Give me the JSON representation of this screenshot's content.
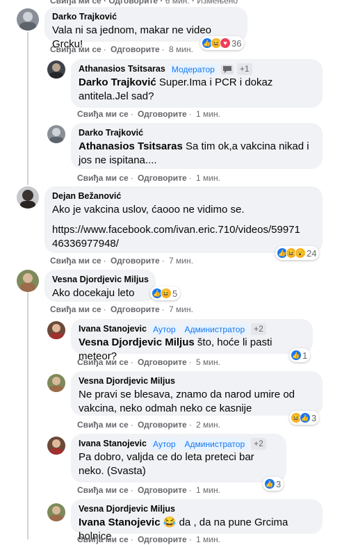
{
  "top_cut": {
    "like": "Свиђа ми се",
    "reply": "Одговорите",
    "time": "6 мин.",
    "edited": "Измењено"
  },
  "comments": [
    {
      "author": "Darko Trajković",
      "text": "Vala ni sa jednom, makar ne video Grcku!",
      "like": "Свиђа ми се",
      "reply": "Одговорите",
      "time": "8 мин.",
      "reactions": "36"
    },
    {
      "author": "Athanasios Tsitsaras",
      "badge": "Модератор",
      "extra": "+1",
      "mention": "Darko Trajković",
      "text": " Super.Ima i PCR i dokaz antitela.Jel sad?",
      "like": "Свиђа ми се",
      "reply": "Одговорите",
      "time": "1 мин."
    },
    {
      "author": "Darko Trajković",
      "mention": "Athanasios Tsitsaras",
      "text": " Sa tim ok,a vakcina nikad i jos ne ispitana....",
      "like": "Свиђа ми се",
      "reply": "Одговорите",
      "time": "1 мин."
    },
    {
      "author": "Dejan Bežanović",
      "text": "Ako je vakcina uslov, ćaooo ne vidimo se.",
      "link": "https://www.facebook.com/ivan.eric.710/videos/5997146336977948/",
      "link1": "https://www.facebook.com/ivan.eric.710/videos/59971",
      "link2": "46336977948/",
      "like": "Свиђа ми се",
      "reply": "Одговорите",
      "time": "7 мин.",
      "reactions": "24"
    },
    {
      "author": "Vesna Djordjevic Miljus",
      "text": "Ako docekaju leto",
      "like": "Свиђа ми се",
      "reply": "Одговорите",
      "time": "7 мин.",
      "reactions": "5"
    },
    {
      "author": "Ivana Stanojevic",
      "badge1": "Аутор",
      "badge2": "Администратор",
      "extra": "+2",
      "mention": "Vesna Djordjevic Miljus",
      "text": " što, hoće li pasti meteor?",
      "like": "Свиђа ми се",
      "reply": "Одговорите",
      "time": "5 мин.",
      "reactions": "1"
    },
    {
      "author": "Vesna Djordjevic Miljus",
      "text": "Ne pravi se blesava, znamo da narod umire od vakcina, neko odmah neko ce kasnije",
      "like": "Свиђа ми се",
      "reply": "Одговорите",
      "time": "2 мин.",
      "reactions": "3"
    },
    {
      "author": "Ivana Stanojevic",
      "badge1": "Аутор",
      "badge2": "Администратор",
      "extra": "+2",
      "text": "Pa dobro, valjda ce do leta preteci bar neko. (Svasta)",
      "like": "Свиђа ми се",
      "reply": "Одговорите",
      "time": "1 мин.",
      "reactions": "3"
    },
    {
      "author": "Vesna Djordjevic Miljus",
      "mention": "Ivana Stanojevic",
      "emoji": "😂",
      "text": " da , da na pune Grcima bolnice",
      "like": "Свиђа ми се",
      "reply": "Одговорите",
      "time": "1 мин."
    }
  ],
  "colors": {
    "bubble": "#f0f2f5",
    "accent": "#1877f2",
    "meta": "#65676b"
  }
}
